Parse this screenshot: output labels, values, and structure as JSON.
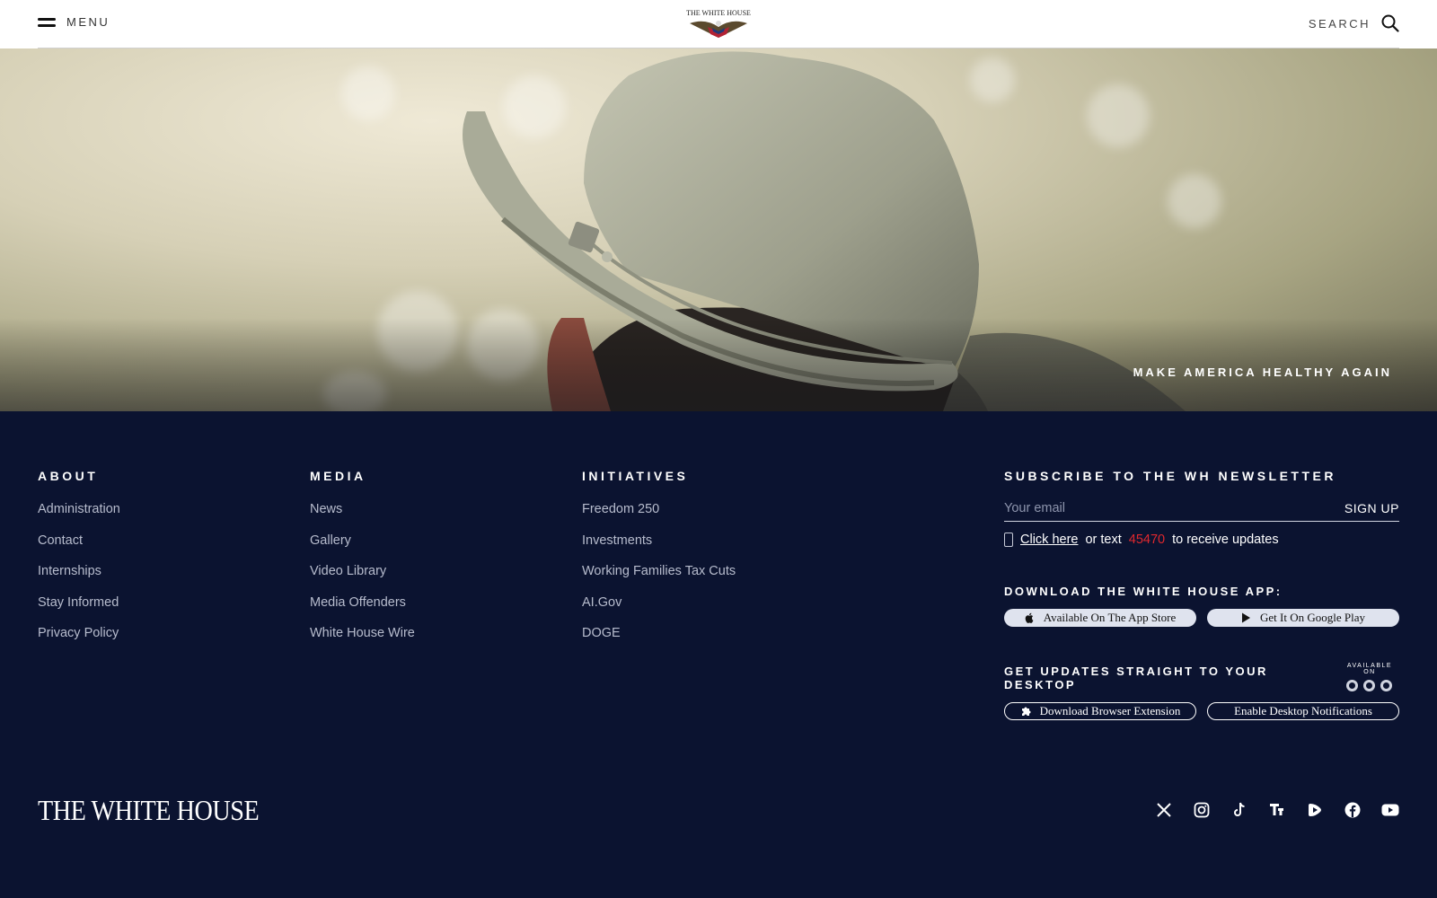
{
  "header": {
    "menu_label": "MENU",
    "search_label": "SEARCH",
    "logo_text": "THE WHITE HOUSE"
  },
  "hero": {
    "caption": "MAKE AMERICA HEALTHY AGAIN"
  },
  "footer": {
    "columns": [
      {
        "title": "ABOUT",
        "items": [
          "Administration",
          "Contact",
          "Internships",
          "Stay Informed",
          "Privacy Policy"
        ]
      },
      {
        "title": "MEDIA",
        "items": [
          "News",
          "Gallery",
          "Video Library",
          "Media Offenders",
          "White House Wire"
        ]
      },
      {
        "title": "INITIATIVES",
        "items": [
          "Freedom 250",
          "Investments",
          "Working Families Tax Cuts",
          "AI.Gov",
          "DOGE"
        ]
      }
    ],
    "newsletter": {
      "title": "SUBSCRIBE TO THE WH NEWSLETTER",
      "email_placeholder": "Your email",
      "signup_label": "SIGN UP",
      "click_here": "Click here",
      "or_text": "or text",
      "short_code": "45470",
      "receive_text": "to receive updates"
    },
    "app": {
      "title": "DOWNLOAD THE WHITE HOUSE APP:",
      "app_store": "Available On The App Store",
      "google_play": "Get It On Google Play"
    },
    "desktop": {
      "title": "GET UPDATES STRAIGHT TO YOUR DESKTOP",
      "available_on": "AVAILABLE ON",
      "extension": "Download Browser Extension",
      "notifications": "Enable Desktop Notifications"
    },
    "wordmark": "THE WHITE HOUSE",
    "social_icons": [
      "x-icon",
      "instagram-icon",
      "tiktok-icon",
      "truth-social-icon",
      "rumble-icon",
      "facebook-icon",
      "youtube-icon"
    ]
  },
  "colors": {
    "navy": "#0b1330",
    "accent_red": "#e0282e",
    "link_gray": "#b7bccd"
  }
}
